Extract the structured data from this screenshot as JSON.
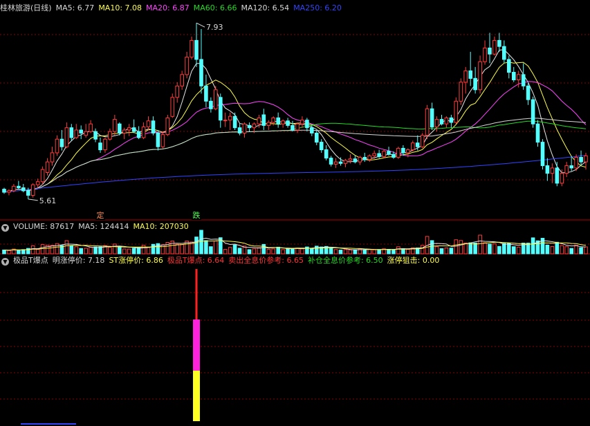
{
  "main_panel": {
    "legend": [
      {
        "text": "桂林旅游(日线)",
        "color": "#d8d8d8"
      },
      {
        "text": "MA5: 6.77",
        "color": "#d8d8d8"
      },
      {
        "text": "MA10: 7.08",
        "color": "#ffff4a"
      },
      {
        "text": "MA20: 6.87",
        "color": "#ff44ff"
      },
      {
        "text": "MA60: 6.66",
        "color": "#22dd22"
      },
      {
        "text": "MA120: 6.54",
        "color": "#d8d8d8"
      },
      {
        "text": "MA250: 6.20",
        "color": "#3344ff"
      }
    ],
    "high_label": "7.93",
    "low_label": "5.61",
    "marker_ding": "定",
    "marker_die": "跌"
  },
  "volume_panel": {
    "legend": [
      {
        "text": "VOLUME: 87617",
        "color": "#d8d8d8"
      },
      {
        "text": "MA5: 124414",
        "color": "#d8d8d8"
      },
      {
        "text": "MA10: 207030",
        "color": "#ffff4a"
      }
    ]
  },
  "indicator_panel": {
    "legend": [
      {
        "text": "极品T爆点",
        "color": "#d8d8d8"
      },
      {
        "text": "明涨停价: 7.18",
        "color": "#d8d8d8"
      },
      {
        "text": "ST涨停价: 6.86",
        "color": "#ffff4a"
      },
      {
        "text": "极品T爆点: 6.64",
        "color": "#ff3333"
      },
      {
        "text": "卖出全息价参考: 6.65",
        "color": "#ff3333"
      },
      {
        "text": "补仓全息价参考: 6.50",
        "color": "#22dd22"
      },
      {
        "text": "涨停狙击: 0.00",
        "color": "#ffff4a"
      }
    ]
  },
  "colors": {
    "up": "#ff3b3b",
    "down": "#54ffff",
    "ma5": "#e8e8e8",
    "ma10": "#ffff4a",
    "ma20": "#ff44ff",
    "ma60": "#22dd22",
    "ma120": "#d8d8d8",
    "ma250": "#3344ff",
    "grid": "#8a0000"
  },
  "chart_data": [
    {
      "type": "candlestick",
      "series": [
        {
          "name": "MA5",
          "value": 6.77
        },
        {
          "name": "MA10",
          "value": 7.08
        },
        {
          "name": "MA20",
          "value": 6.87
        },
        {
          "name": "MA60",
          "value": 6.66
        },
        {
          "name": "MA120",
          "value": 6.54
        },
        {
          "name": "MA250",
          "value": 6.2
        }
      ],
      "annotations": [
        {
          "text": "7.93",
          "kind": "period-high",
          "y": 7.93
        },
        {
          "text": "5.61",
          "kind": "period-low",
          "y": 5.61
        }
      ],
      "ylim": [
        5.5,
        8.05
      ],
      "ohlc": [
        [
          5.74,
          5.76,
          5.68,
          5.7
        ],
        [
          5.7,
          5.74,
          5.66,
          5.72
        ],
        [
          5.72,
          5.81,
          5.7,
          5.78
        ],
        [
          5.78,
          5.85,
          5.74,
          5.76
        ],
        [
          5.76,
          5.81,
          5.7,
          5.72
        ],
        [
          5.72,
          5.76,
          5.61,
          5.66
        ],
        [
          5.66,
          5.82,
          5.63,
          5.8
        ],
        [
          5.8,
          5.88,
          5.76,
          5.84
        ],
        [
          5.84,
          6.04,
          5.8,
          6.0
        ],
        [
          5.96,
          6.15,
          5.92,
          6.1
        ],
        [
          6.1,
          6.3,
          6.05,
          6.22
        ],
        [
          6.22,
          6.45,
          6.18,
          6.4
        ],
        [
          6.4,
          6.52,
          6.25,
          6.3
        ],
        [
          6.3,
          6.62,
          6.28,
          6.55
        ],
        [
          6.55,
          6.6,
          6.38,
          6.42
        ],
        [
          6.42,
          6.6,
          6.4,
          6.52
        ],
        [
          6.52,
          6.58,
          6.4,
          6.48
        ],
        [
          6.45,
          6.6,
          6.42,
          6.5
        ],
        [
          6.5,
          6.65,
          6.48,
          6.6
        ],
        [
          6.5,
          6.54,
          6.36,
          6.4
        ],
        [
          6.35,
          6.42,
          6.22,
          6.26
        ],
        [
          6.26,
          6.42,
          6.22,
          6.4
        ],
        [
          6.4,
          6.54,
          6.38,
          6.5
        ],
        [
          6.5,
          6.72,
          6.45,
          6.66
        ],
        [
          6.6,
          6.62,
          6.45,
          6.48
        ],
        [
          6.48,
          6.55,
          6.4,
          6.52
        ],
        [
          6.52,
          6.6,
          6.44,
          6.55
        ],
        [
          6.55,
          6.66,
          6.48,
          6.5
        ],
        [
          6.5,
          6.57,
          6.4,
          6.42
        ],
        [
          6.42,
          6.62,
          6.4,
          6.56
        ],
        [
          6.56,
          6.7,
          6.52,
          6.64
        ],
        [
          6.64,
          6.7,
          6.45,
          6.48
        ],
        [
          6.48,
          6.52,
          6.25,
          6.3
        ],
        [
          6.3,
          6.5,
          6.28,
          6.46
        ],
        [
          6.46,
          6.72,
          6.44,
          6.68
        ],
        [
          6.7,
          7.0,
          6.68,
          6.95
        ],
        [
          6.95,
          7.15,
          6.88,
          7.1
        ],
        [
          7.1,
          7.3,
          7.05,
          7.25
        ],
        [
          7.25,
          7.55,
          7.2,
          7.48
        ],
        [
          7.48,
          7.75,
          7.45,
          7.7
        ],
        [
          7.7,
          7.93,
          7.35,
          7.45
        ],
        [
          7.45,
          7.85,
          7.0,
          7.1
        ],
        [
          7.1,
          7.25,
          6.82,
          6.9
        ],
        [
          6.9,
          6.95,
          6.75,
          6.8
        ],
        [
          6.8,
          7.1,
          6.78,
          7.05
        ],
        [
          6.95,
          7.0,
          6.55,
          6.65
        ],
        [
          6.65,
          6.75,
          6.56,
          6.65
        ],
        [
          6.65,
          6.75,
          6.52,
          6.7
        ],
        [
          6.7,
          6.75,
          6.52,
          6.55
        ],
        [
          6.55,
          6.6,
          6.45,
          6.48
        ],
        [
          6.48,
          6.62,
          6.42,
          6.6
        ],
        [
          6.58,
          6.62,
          6.5,
          6.55
        ],
        [
          6.55,
          6.62,
          6.48,
          6.6
        ],
        [
          6.6,
          6.72,
          6.55,
          6.68
        ],
        [
          6.72,
          6.8,
          6.52,
          6.58
        ],
        [
          6.58,
          6.65,
          6.52,
          6.62
        ],
        [
          6.62,
          6.7,
          6.58,
          6.68
        ],
        [
          6.68,
          6.75,
          6.55,
          6.6
        ],
        [
          6.6,
          6.66,
          6.55,
          6.64
        ],
        [
          6.64,
          6.68,
          6.55,
          6.58
        ],
        [
          6.58,
          6.64,
          6.5,
          6.52
        ],
        [
          6.52,
          6.62,
          6.48,
          6.6
        ],
        [
          6.6,
          6.7,
          6.55,
          6.65
        ],
        [
          6.65,
          6.68,
          6.5,
          6.55
        ],
        [
          6.55,
          6.58,
          6.44,
          6.48
        ],
        [
          6.48,
          6.52,
          6.32,
          6.36
        ],
        [
          6.36,
          6.4,
          6.22,
          6.26
        ],
        [
          6.26,
          6.32,
          6.12,
          6.15
        ],
        [
          6.15,
          6.18,
          6.04,
          6.07
        ],
        [
          6.07,
          6.15,
          6.02,
          6.1
        ],
        [
          6.1,
          6.16,
          6.05,
          6.08
        ],
        [
          6.08,
          6.14,
          6.03,
          6.12
        ],
        [
          6.12,
          6.2,
          6.08,
          6.14
        ],
        [
          6.14,
          6.18,
          6.08,
          6.1
        ],
        [
          6.1,
          6.18,
          6.06,
          6.16
        ],
        [
          6.16,
          6.22,
          6.1,
          6.13
        ],
        [
          6.13,
          6.2,
          6.1,
          6.18
        ],
        [
          6.18,
          6.25,
          6.14,
          6.21
        ],
        [
          6.21,
          6.26,
          6.15,
          6.17
        ],
        [
          6.17,
          6.26,
          6.15,
          6.24
        ],
        [
          6.24,
          6.3,
          6.18,
          6.2
        ],
        [
          6.2,
          6.24,
          6.14,
          6.16
        ],
        [
          6.16,
          6.3,
          6.14,
          6.28
        ],
        [
          6.28,
          6.32,
          6.18,
          6.22
        ],
        [
          6.22,
          6.28,
          6.16,
          6.26
        ],
        [
          6.26,
          6.38,
          6.24,
          6.35
        ],
        [
          6.35,
          6.45,
          6.25,
          6.3
        ],
        [
          6.3,
          6.48,
          6.28,
          6.45
        ],
        [
          6.45,
          6.85,
          6.4,
          6.8
        ],
        [
          6.8,
          6.88,
          6.52,
          6.56
        ],
        [
          6.56,
          6.7,
          6.5,
          6.66
        ],
        [
          6.66,
          6.72,
          6.58,
          6.6
        ],
        [
          6.6,
          6.7,
          6.55,
          6.68
        ],
        [
          6.68,
          6.72,
          6.55,
          6.62
        ],
        [
          6.62,
          6.95,
          6.6,
          6.9
        ],
        [
          6.9,
          7.2,
          6.85,
          7.15
        ],
        [
          7.15,
          7.35,
          7.0,
          7.3
        ],
        [
          7.3,
          7.55,
          7.1,
          7.2
        ],
        [
          7.2,
          7.35,
          7.0,
          7.05
        ],
        [
          7.05,
          7.5,
          7.0,
          7.42
        ],
        [
          7.42,
          7.7,
          7.38,
          7.6
        ],
        [
          7.6,
          7.8,
          7.4,
          7.52
        ],
        [
          7.52,
          7.75,
          7.5,
          7.7
        ],
        [
          7.7,
          7.8,
          7.55,
          7.62
        ],
        [
          7.62,
          7.7,
          7.4,
          7.45
        ],
        [
          7.45,
          7.5,
          7.2,
          7.28
        ],
        [
          7.28,
          7.35,
          7.15,
          7.18
        ],
        [
          7.18,
          7.3,
          7.08,
          7.25
        ],
        [
          7.25,
          7.4,
          7.05,
          7.1
        ],
        [
          7.1,
          7.15,
          6.85,
          6.92
        ],
        [
          6.92,
          6.96,
          6.55,
          6.6
        ],
        [
          6.6,
          6.65,
          6.3,
          6.36
        ],
        [
          6.36,
          6.4,
          6.0,
          6.05
        ],
        [
          6.05,
          6.15,
          5.85,
          5.95
        ],
        [
          5.95,
          6.08,
          5.82,
          6.02
        ],
        [
          6.02,
          6.1,
          5.78,
          5.82
        ],
        [
          5.82,
          6.0,
          5.78,
          5.95
        ],
        [
          5.95,
          6.1,
          5.9,
          6.05
        ],
        [
          6.05,
          6.18,
          5.98,
          6.02
        ],
        [
          6.02,
          6.2,
          5.98,
          6.16
        ],
        [
          6.16,
          6.25,
          6.05,
          6.1
        ],
        [
          6.1,
          6.22,
          6.0,
          6.18
        ]
      ],
      "volume_ylim": [
        0,
        1300000
      ]
    },
    {
      "type": "bar",
      "title": "极品T爆点",
      "series": [
        {
          "name": "明涨停价",
          "value": 7.18
        },
        {
          "name": "ST涨停价",
          "value": 6.86
        },
        {
          "name": "极品T爆点",
          "value": 6.64
        },
        {
          "name": "卖出全息价参考",
          "value": 6.65
        },
        {
          "name": "补仓全息价参考",
          "value": 6.5
        },
        {
          "name": "涨停狙击",
          "value": 0.0
        }
      ]
    }
  ]
}
